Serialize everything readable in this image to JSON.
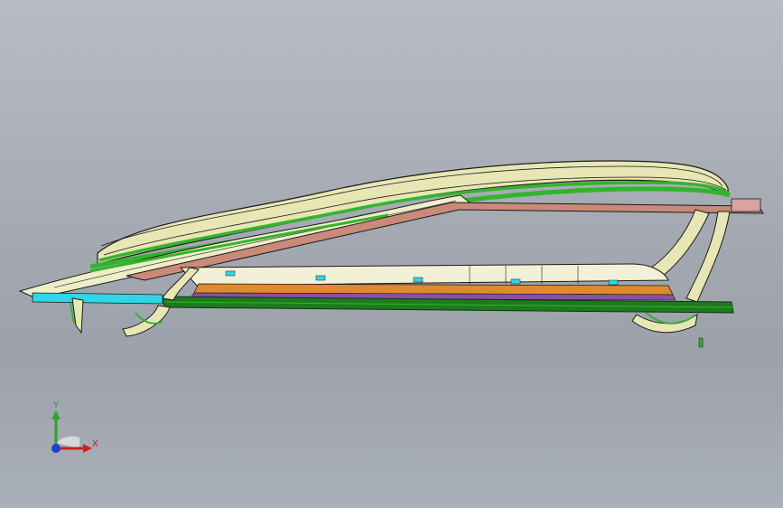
{
  "viewport": {
    "background_top": "#b7bcc6",
    "background_bottom": "#9ca1aa"
  },
  "model": {
    "colors": {
      "shell_cream": "#e8e6b4",
      "shell_outline": "#1a1a1a",
      "green_band": "#33b42d",
      "dark_green_rail": "#1e7a1e",
      "salmon_panel": "#c98a7a",
      "cyan_strip": "#2fd7e6",
      "orange_layer": "#e08a2e",
      "purple_layer": "#8a4fa8",
      "light_panel": "#eeeec8"
    }
  },
  "triad": {
    "y_label": "Y",
    "x_label": "X",
    "y_color": "#2ba32b",
    "x_color": "#cc2222",
    "z_color": "#1f3fcf"
  }
}
